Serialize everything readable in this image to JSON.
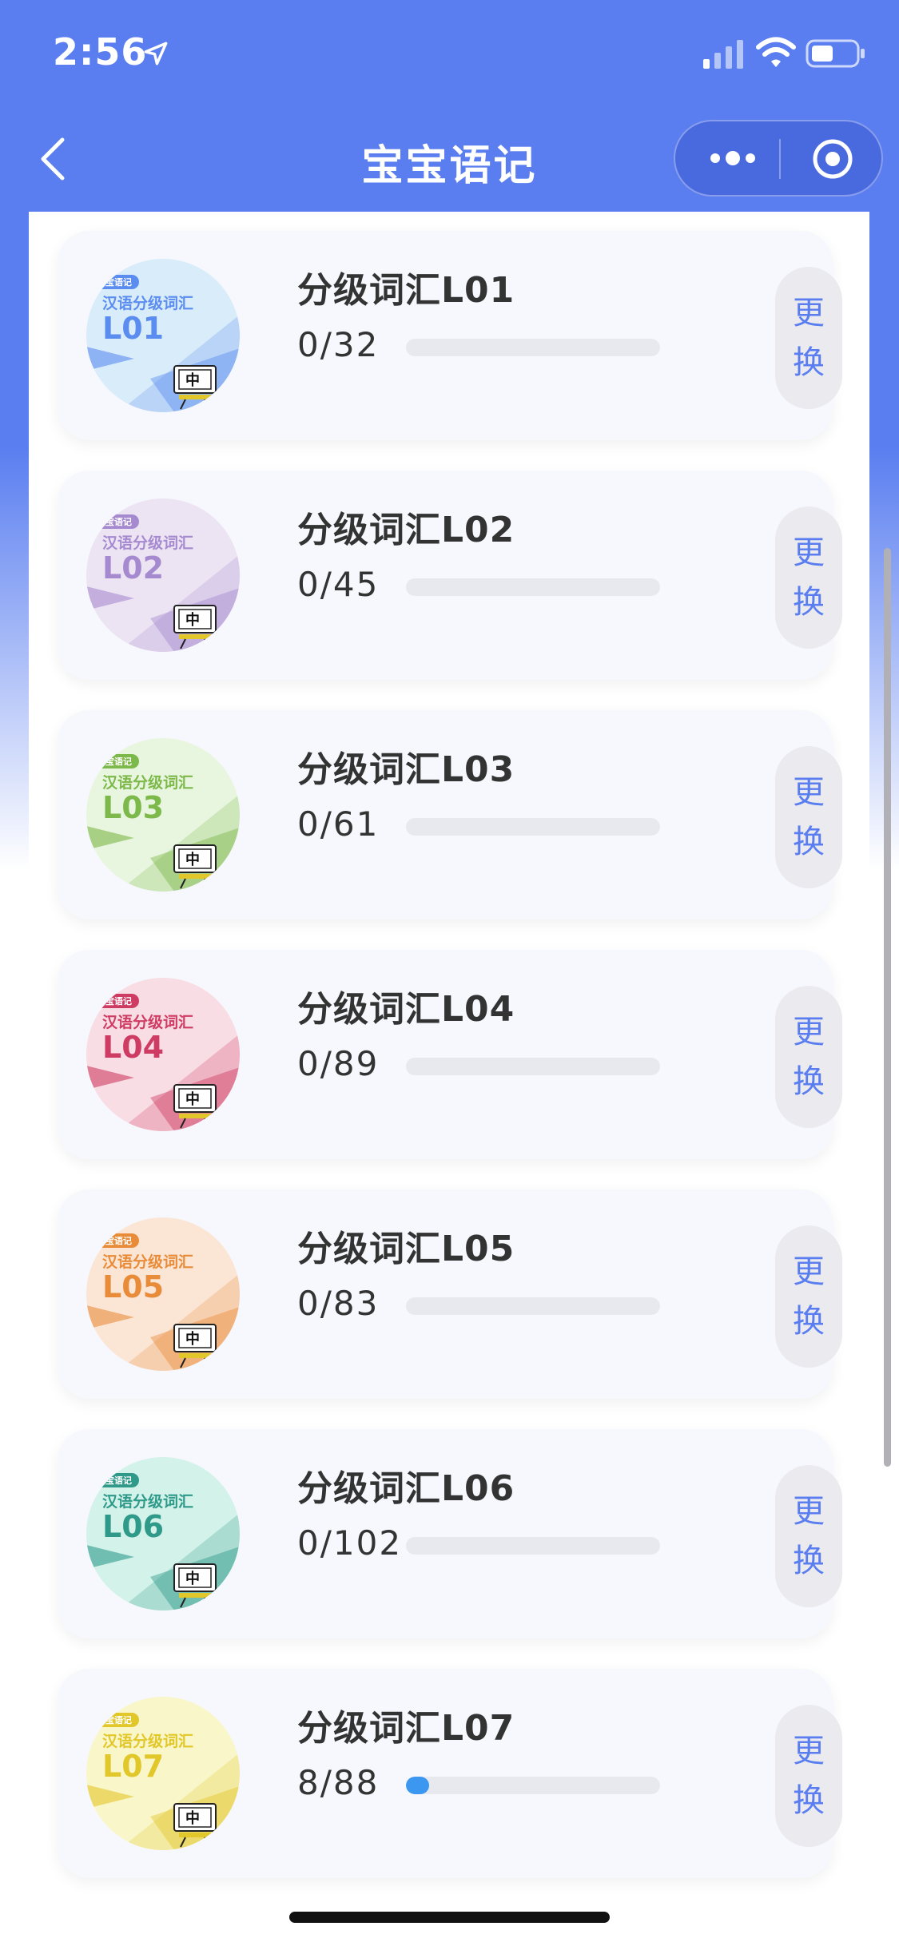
{
  "status_bar": {
    "time": "2:56"
  },
  "nav": {
    "title": "宝宝语记"
  },
  "cards": [
    {
      "title": "分级词汇L01",
      "count": "0/32",
      "progress": 0,
      "badge": "宝宝语记",
      "cover_title": "汉语分级词汇",
      "level": "L01",
      "zh": "中",
      "color": "#5b8df0",
      "bg": "#d8ecf9",
      "button": [
        "更",
        "换"
      ]
    },
    {
      "title": "分级词汇L02",
      "count": "0/45",
      "progress": 0,
      "badge": "宝宝语记",
      "cover_title": "汉语分级词汇",
      "level": "L02",
      "zh": "中",
      "color": "#a68ad0",
      "bg": "#ede4f3",
      "button": [
        "更",
        "换"
      ]
    },
    {
      "title": "分级词汇L03",
      "count": "0/61",
      "progress": 0,
      "badge": "宝宝语记",
      "cover_title": "汉语分级词汇",
      "level": "L03",
      "zh": "中",
      "color": "#7cb84a",
      "bg": "#e9f6df",
      "button": [
        "更",
        "换"
      ]
    },
    {
      "title": "分级词汇L04",
      "count": "0/89",
      "progress": 0,
      "badge": "宝宝语记",
      "cover_title": "汉语分级词汇",
      "level": "L04",
      "zh": "中",
      "color": "#cf3c63",
      "bg": "#f8dde4",
      "button": [
        "更",
        "换"
      ]
    },
    {
      "title": "分级词汇L05",
      "count": "0/83",
      "progress": 0,
      "badge": "宝宝语记",
      "cover_title": "汉语分级词汇",
      "level": "L05",
      "zh": "中",
      "color": "#e88c3a",
      "bg": "#fbe6d6",
      "button": [
        "更",
        "换"
      ]
    },
    {
      "title": "分级词汇L06",
      "count": "0/102",
      "progress": 0,
      "badge": "宝宝语记",
      "cover_title": "汉语分级词汇",
      "level": "L06",
      "zh": "中",
      "color": "#2f9a8a",
      "bg": "#d3f2ea",
      "button": [
        "更",
        "换"
      ]
    },
    {
      "title": "分级词汇L07",
      "count": "8/88",
      "progress": 0.091,
      "badge": "宝宝语记",
      "cover_title": "汉语分级词汇",
      "level": "L07",
      "zh": "中",
      "color": "#e2c72a",
      "bg": "#f9f6c9",
      "button": [
        "更",
        "换"
      ]
    }
  ]
}
